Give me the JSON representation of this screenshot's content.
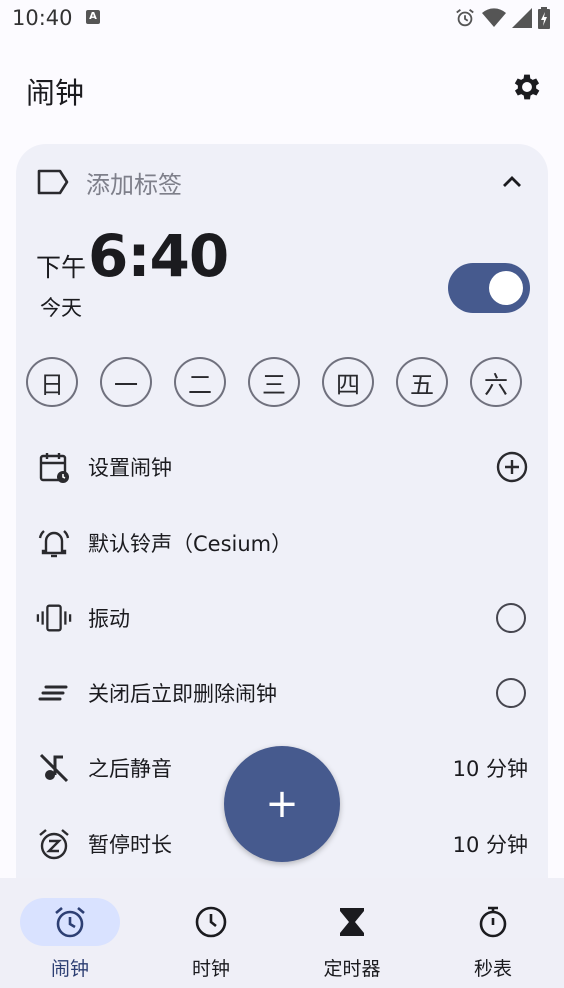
{
  "status_bar": {
    "time": "10:40",
    "notification_icon": "A"
  },
  "app_bar": {
    "title": "闹钟"
  },
  "alarm": {
    "label_placeholder": "添加标签",
    "ampm": "下午",
    "time": "6:40",
    "day_label": "今天",
    "enabled": true,
    "days": [
      "日",
      "一",
      "二",
      "三",
      "四",
      "五",
      "六"
    ]
  },
  "options": {
    "set_alarm": "设置闹钟",
    "ringtone": "默认铃声（Cesium）",
    "vibrate": "振动",
    "delete_after_dismiss": "关闭后立即删除闹钟",
    "silence_after": "之后静音",
    "silence_after_value": "10 分钟",
    "snooze_length": "暂停时长",
    "snooze_length_value": "10 分钟"
  },
  "fab": {
    "label": "+"
  },
  "nav": [
    "闹钟",
    "时钟",
    "定时器",
    "秒表"
  ],
  "colors": {
    "accent": "#465a8e",
    "nav_active_bg": "#d9e2ff",
    "card_bg": "#eff0f8"
  }
}
